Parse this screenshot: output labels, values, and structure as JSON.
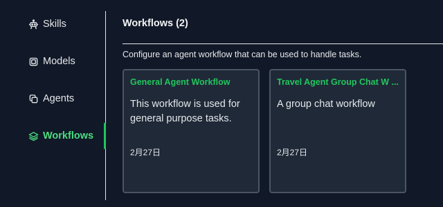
{
  "sidebar": {
    "items": [
      {
        "label": "Skills",
        "icon": "robot-icon",
        "active": false
      },
      {
        "label": "Models",
        "icon": "cpu-chip-icon",
        "active": false
      },
      {
        "label": "Agents",
        "icon": "duplicate-icon",
        "active": false
      },
      {
        "label": "Workflows",
        "icon": "layers-icon",
        "active": true
      }
    ]
  },
  "main": {
    "title": "Workflows (2)",
    "description": "Configure an agent workflow that can be used to handle tasks.",
    "cards": [
      {
        "title": "General Agent Workflow",
        "description": "This workflow is used for general purpose tasks.",
        "date": "2月27日"
      },
      {
        "title": "Travel Agent Group Chat W ...",
        "description": "A group chat workflow",
        "date": "2月27日"
      }
    ]
  },
  "colors": {
    "background": "#111827",
    "card_background": "#1f2937",
    "card_border": "#4b5563",
    "accent": "#22c55e",
    "text": "#e5e7eb"
  }
}
